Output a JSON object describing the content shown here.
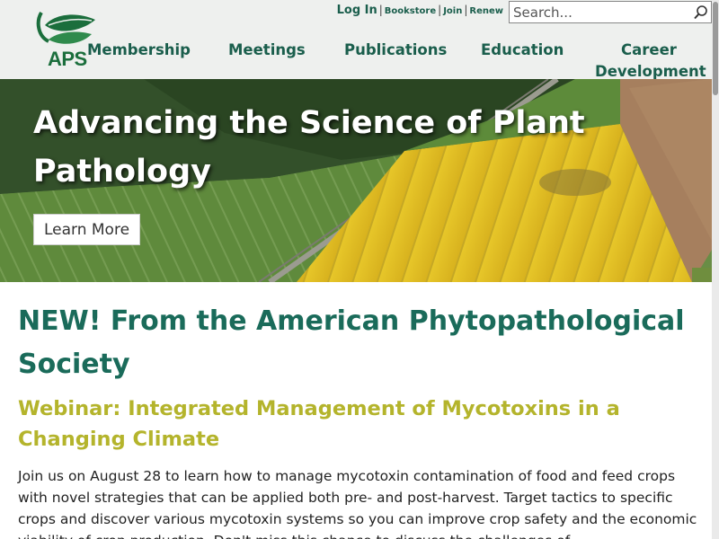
{
  "logo": {
    "text": "APS"
  },
  "utility": {
    "login": "Log In",
    "separator": "|",
    "bookstore": "Bookstore",
    "join": "Join",
    "renew": "Renew"
  },
  "search": {
    "placeholder": "Search..."
  },
  "nav": {
    "membership": "Membership",
    "meetings": "Meetings",
    "publications": "Publications",
    "education": "Education",
    "career_line1": "Career",
    "career_line2": "Development"
  },
  "hero": {
    "title": "Advancing the Science of Plant Pathology",
    "button": "Learn More"
  },
  "content": {
    "heading": "NEW! From the American Phytopathological Society",
    "subheading": "Webinar: Integrated Management of Mycotoxins in a Changing Climate",
    "paragraph": "Join us on August 28 to learn how to manage mycotoxin contamination of food and feed crops with novel strategies that can be applied both pre- and post-harvest. Target tactics to specific crops and discover various mycotoxin systems so you can improve crop safety and the economic viability of crop production. Don't miss this chance to discuss the challenges of"
  },
  "colors": {
    "brand_green": "#1a5e4c",
    "heading_teal": "#1a6b5a",
    "subheading_olive": "#b4b42c",
    "header_bg": "#eef0ee"
  },
  "icons": {
    "search": "magnifier-icon",
    "logo": "leaf-icon"
  }
}
